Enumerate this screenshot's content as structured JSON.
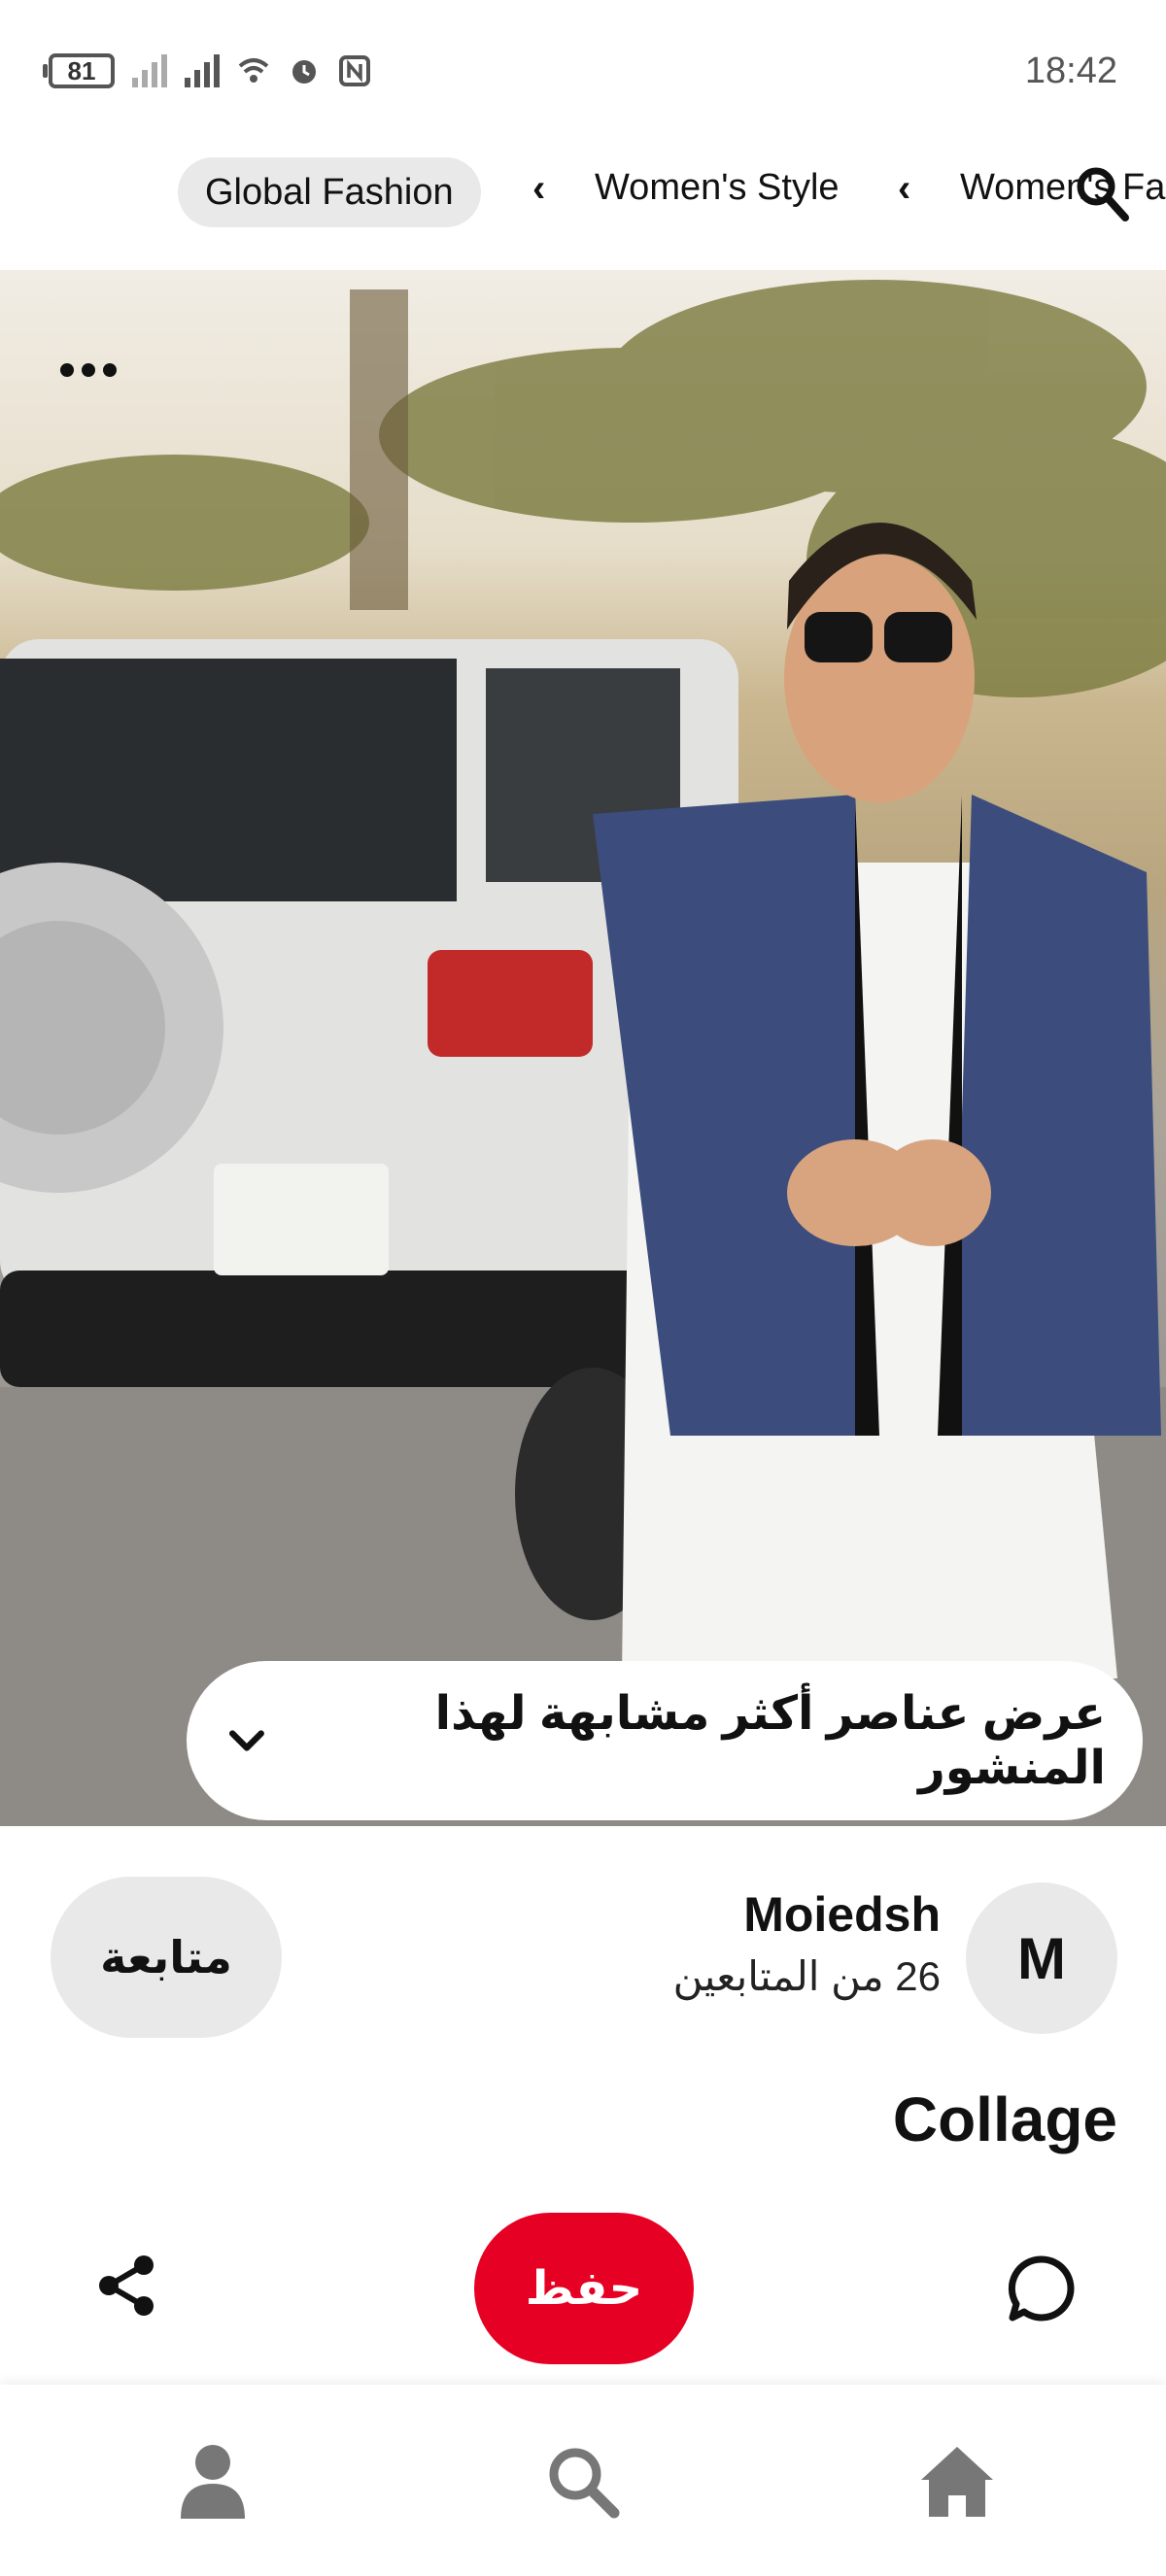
{
  "status_bar": {
    "battery": "81",
    "time": "18:42"
  },
  "breadcrumbs": {
    "active_chip": "Global Fashion",
    "items": [
      "Women's Style",
      "Women's Fa"
    ]
  },
  "pin": {
    "similar_button_label": "عرض عناصر أكثر مشابهة لهذا المنشور",
    "title": "Collage"
  },
  "creator": {
    "name": "Moiedsh",
    "followers": "26 من المتابعين",
    "avatar_initial": "M",
    "follow_label": "متابعة"
  },
  "actions": {
    "save_label": "حفظ"
  },
  "icons": {
    "share": "share-icon",
    "comment": "comment-icon",
    "more": "more-icon",
    "search": "search-icon",
    "profile": "profile-icon",
    "home": "home-icon"
  },
  "colors": {
    "save_red": "#e60023",
    "chip_gray": "#e9e9e9"
  }
}
